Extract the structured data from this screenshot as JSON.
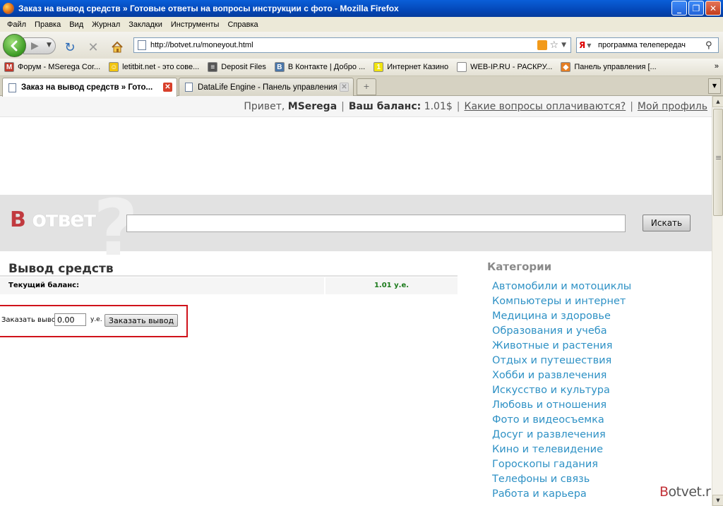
{
  "window": {
    "title": "Заказ на вывод средств » Готовые ответы на вопросы инструкции с фото - Mozilla Firefox",
    "minimize_glyph": "_",
    "maximize_glyph": "❐",
    "close_glyph": "✕"
  },
  "menu": [
    "Файл",
    "Правка",
    "Вид",
    "Журнал",
    "Закладки",
    "Инструменты",
    "Справка"
  ],
  "navigation": {
    "url": "http://botvet.ru/moneyout.html",
    "search_engine_glyph": "Я",
    "search_query": "программа телепередач"
  },
  "bookmarks": [
    {
      "label": "Форум - MSerega Cor...",
      "icon": "gmail-icon",
      "color": "#c0392b",
      "glyph": "M"
    },
    {
      "label": "letitbit.net - это сове...",
      "icon": "smiley-icon",
      "color": "#f1c40f",
      "glyph": "☺"
    },
    {
      "label": "Deposit Files",
      "icon": "depositfiles-icon",
      "color": "#555555",
      "glyph": "≡"
    },
    {
      "label": "В Контакте | Добро ...",
      "icon": "vk-icon",
      "color": "#4a76a8",
      "glyph": "B"
    },
    {
      "label": "Интернет Казино",
      "icon": "casino-icon",
      "color": "#f1e40f",
      "glyph": "1"
    },
    {
      "label": "WEB-IP.RU - РАСКРУ...",
      "icon": "page-icon",
      "color": "#ffffff",
      "glyph": ""
    },
    {
      "label": "Панель управления [...",
      "icon": "panel-icon",
      "color": "#e67e22",
      "glyph": "◆"
    }
  ],
  "bookmarks_more": "»",
  "tabs": [
    {
      "label": "Заказ на вывод средств » Гото...",
      "active": true
    },
    {
      "label": "DataLife Engine - Панель управления",
      "active": false
    }
  ],
  "new_tab_glyph": "+",
  "tab_close_glyph": "✕",
  "page": {
    "greeting_prefix": "Привет,",
    "username": "MSerega",
    "separator": "|",
    "balance_label": "Ваш баланс:",
    "balance_value": "1.01$",
    "paid_questions_link": "Какие вопросы оплачиваются?",
    "profile_link": "Мой профиль",
    "logo_b": "В",
    "logo_rest": " ответ",
    "logo_qmark": "?",
    "search_button": "Искать",
    "withdraw_title": "Вывод средств",
    "current_balance_label": "Текущий баланс:",
    "current_balance_value": "1.01 у.е.",
    "order_label": "Заказать вывод",
    "order_amount": "0.00",
    "order_unit": "у.е.",
    "order_button": "Заказать вывод",
    "categories_title": "Категории",
    "categories": [
      "Автомобили и мотоциклы",
      "Компьютеры и интернет",
      "Медицина и здоровье",
      "Образования и учеба",
      "Животные и растения",
      "Отдых и путешествия",
      "Хобби и развлечения",
      "Искусство и культура",
      "Любовь и отношения",
      "Фото и видеосъемка",
      "Досуг и развлечения",
      "Кино и телевидение",
      "Гороскопы гадания",
      "Телефоны и связь",
      "Работа и карьера"
    ],
    "watermark_b": "B",
    "watermark_rest": "otvet.ru"
  },
  "colors": {
    "accent_red": "#c13a3f",
    "link_blue": "#2e91c5",
    "balance_green": "#1b7a1b",
    "highlight_box": "#d0121b"
  }
}
